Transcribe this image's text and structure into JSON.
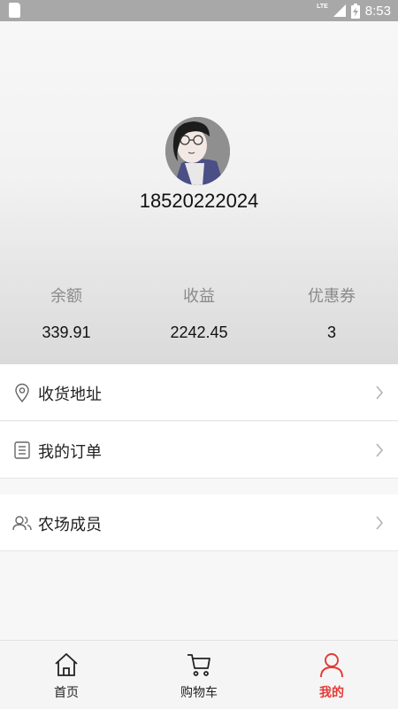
{
  "status_bar": {
    "time": "8:53",
    "network": "LTE"
  },
  "profile": {
    "phone": "18520222024",
    "stats": [
      {
        "label": "余额",
        "value": "339.91"
      },
      {
        "label": "收益",
        "value": "2242.45"
      },
      {
        "label": "优惠券",
        "value": "3"
      }
    ]
  },
  "menu": {
    "address": "收货地址",
    "orders": "我的订单",
    "members": "农场成员"
  },
  "tabbar": {
    "home": "首页",
    "cart": "购物车",
    "mine": "我的",
    "active_color": "#e53935"
  }
}
